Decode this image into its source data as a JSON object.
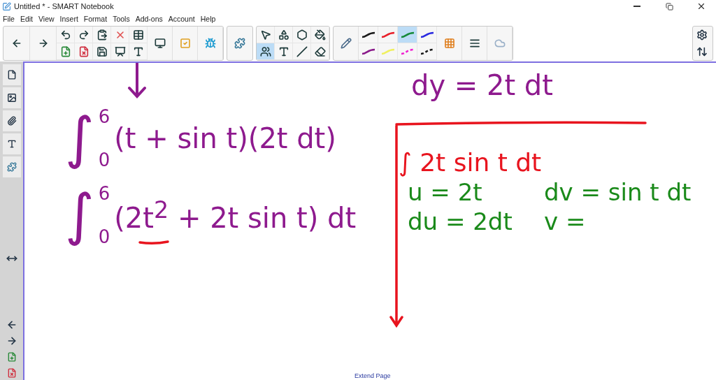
{
  "window": {
    "title": "Untitled * - SMART Notebook"
  },
  "menu": [
    "File",
    "Edit",
    "View",
    "Insert",
    "Format",
    "Tools",
    "Add-ons",
    "Account",
    "Help"
  ],
  "tools": [
    {
      "selected": false
    },
    {
      "selected": false
    },
    {
      "selected": false
    },
    {
      "selected": false
    },
    {
      "selected": true
    },
    {
      "selected": false
    },
    {
      "selected": false
    },
    {
      "selected": false
    }
  ],
  "pens": [
    {
      "color": "#1a1a1a",
      "kind": "solid",
      "selected": false
    },
    {
      "color": "#e8202a",
      "kind": "solid",
      "selected": false
    },
    {
      "color": "#168a3a",
      "kind": "solid",
      "selected": true
    },
    {
      "color": "#2a2ae0",
      "kind": "solid",
      "selected": false
    },
    {
      "color": "#8a1a8a",
      "kind": "solid",
      "selected": false
    },
    {
      "color": "#f0f060",
      "kind": "solid",
      "selected": false
    },
    {
      "color": "#f020d0",
      "kind": "dashed",
      "selected": false
    },
    {
      "color": "#1a1a1a",
      "kind": "dashed",
      "selected": false
    }
  ],
  "ink": [
    {
      "kind": "line",
      "text": "dy = 2t dt",
      "color": "#8e1a8e"
    },
    {
      "kind": "integral",
      "sign": "∫",
      "upper": "6",
      "lower": "0",
      "text": "(t + sin t)(2t dt)",
      "color": "#8e1a8e"
    },
    {
      "kind": "integral",
      "sign": "∫",
      "upper": "6",
      "lower": "0",
      "text": "(2t$^{2}$ + 2t sin t) dt",
      "color": "#8e1a8e"
    },
    {
      "kind": "line",
      "text": "∫ 2t sin t dt",
      "color": "#e8141e"
    },
    {
      "kind": "line",
      "text": "u = 2t",
      "color": "#1a8a1a"
    },
    {
      "kind": "line",
      "text": "dv = sin t dt",
      "color": "#1a8a1a"
    },
    {
      "kind": "line",
      "text": "du = 2dt",
      "color": "#1a8a1a"
    },
    {
      "kind": "line",
      "text": "v =",
      "color": "#1a8a1a"
    }
  ],
  "extend_page": "Extend Page"
}
